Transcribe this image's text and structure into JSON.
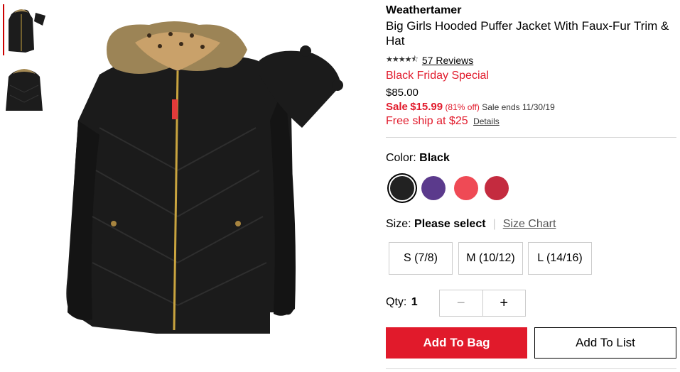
{
  "gallery": {
    "thumbnails": [
      {
        "icon": "jacket-with-hat-thumbnail",
        "selected": true
      },
      {
        "icon": "jacket-back-thumbnail",
        "selected": false
      }
    ],
    "main_image_icon": "puffer-jacket-with-hat-image"
  },
  "product": {
    "brand": "Weathertamer",
    "title": "Big Girls Hooded Puffer Jacket With Faux-Fur Trim & Hat",
    "rating": 4.5,
    "stars_icon": "star-rating-icon",
    "reviews_label": "57 Reviews",
    "promo": "Black Friday Special",
    "original_price": "$85.00",
    "sale_prefix": "Sale",
    "sale_price": "$15.99",
    "discount": "(81% off)",
    "sale_ends": "Sale ends 11/30/19",
    "free_ship": "Free ship at $25",
    "details_link": "Details"
  },
  "color": {
    "label": "Color:",
    "selected": "Black",
    "swatches": [
      {
        "name": "black",
        "hex": "#222222",
        "selected": true
      },
      {
        "name": "purple",
        "hex": "#5b3a8c",
        "selected": false
      },
      {
        "name": "coral",
        "hex": "#ef4a55",
        "selected": false
      },
      {
        "name": "red",
        "hex": "#c42b3f",
        "selected": false
      }
    ]
  },
  "size": {
    "label": "Size:",
    "selected": "Please select",
    "chart_link": "Size Chart",
    "options": [
      "S (7/8)",
      "M (10/12)",
      "L (14/16)"
    ]
  },
  "qty": {
    "label": "Qty:",
    "value": "1",
    "minus": "−",
    "plus": "+"
  },
  "actions": {
    "add_to_bag": "Add To Bag",
    "add_to_list": "Add To List"
  },
  "colors": {
    "accent": "#e11a2b"
  }
}
